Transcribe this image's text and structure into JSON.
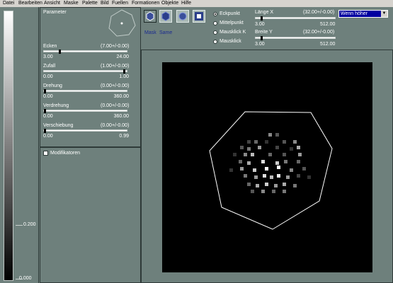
{
  "menu": [
    "Datei",
    "Bearbeiten",
    "Ansicht",
    "Maske",
    "Palette",
    "Bild",
    "Fuellen",
    "Formationen",
    "Objekte",
    "Hilfe"
  ],
  "gradient_panel": {
    "tick_upper": "0.200",
    "tick_lower": "0.000"
  },
  "parameters": {
    "title": "Parameter",
    "sliders": [
      {
        "label": "Ecken",
        "value": "(7.00+/-0.00)",
        "min": "3.00",
        "max": "24.00",
        "position": 0.19
      },
      {
        "label": "Zufall",
        "value": "(1.00+/-0.00)",
        "min": "0.00",
        "max": "1.00",
        "position": 1.0
      },
      {
        "label": "Drehung",
        "value": "(0.00+/-0.00)",
        "min": "0.00",
        "max": "360.00",
        "position": 0.0
      },
      {
        "label": "Verdrehung",
        "value": "(0.00+/-0.00)",
        "min": "0.00",
        "max": "360.00",
        "position": 0.0
      },
      {
        "label": "Verschiebung",
        "value": "(0.00+/-0.00)",
        "min": "0.00",
        "max": "0.99",
        "position": 0.0
      }
    ]
  },
  "modifiers": {
    "checkbox_label": "Modifikatoren",
    "checked": false
  },
  "toolbar": {
    "shapes": [
      {
        "icon": "hexagon-outline-icon",
        "selected": true
      },
      {
        "icon": "hexagon-filled-icon",
        "selected": false
      },
      {
        "icon": "circle-icon",
        "selected": false
      },
      {
        "icon": "square-glow-icon",
        "selected": false
      }
    ],
    "mask_label": "Mask",
    "same_label": "Same",
    "radios": [
      {
        "label": "Eckpunkt",
        "checked": true
      },
      {
        "label": "Mittelpunkt",
        "checked": false
      },
      {
        "label": "Mausklick K",
        "checked": false
      },
      {
        "label": "Mausklick",
        "checked": false
      }
    ],
    "laenge": {
      "label": "Länge X",
      "value": "(32.00+/-0.00)",
      "min": "3.00",
      "max": "512.00",
      "position": 0.06
    },
    "breite": {
      "label": "Breite Y",
      "value": "(32.00+/-0.00)",
      "min": "3.00",
      "max": "512.00",
      "position": 0.06
    },
    "mode_select": "Wenn höher"
  },
  "colors": {
    "panel": "#6e807c",
    "canvas": "#000000",
    "select_bg": "#0000a0"
  }
}
